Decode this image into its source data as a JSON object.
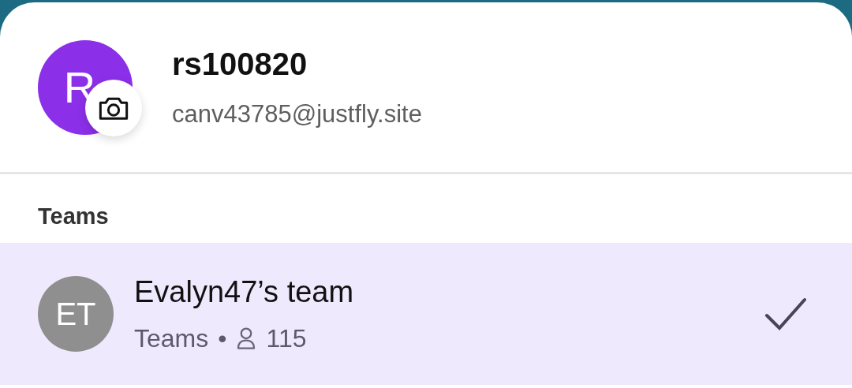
{
  "profile": {
    "avatar_initial": "R",
    "username": "rs100820",
    "email": "canv43785@justfly.site"
  },
  "teams_heading": "Teams",
  "teams": [
    {
      "initials": "ET",
      "name": "Evalyn47’s team",
      "type": "Teams",
      "separator": "•",
      "members": "115",
      "selected": true
    }
  ]
}
